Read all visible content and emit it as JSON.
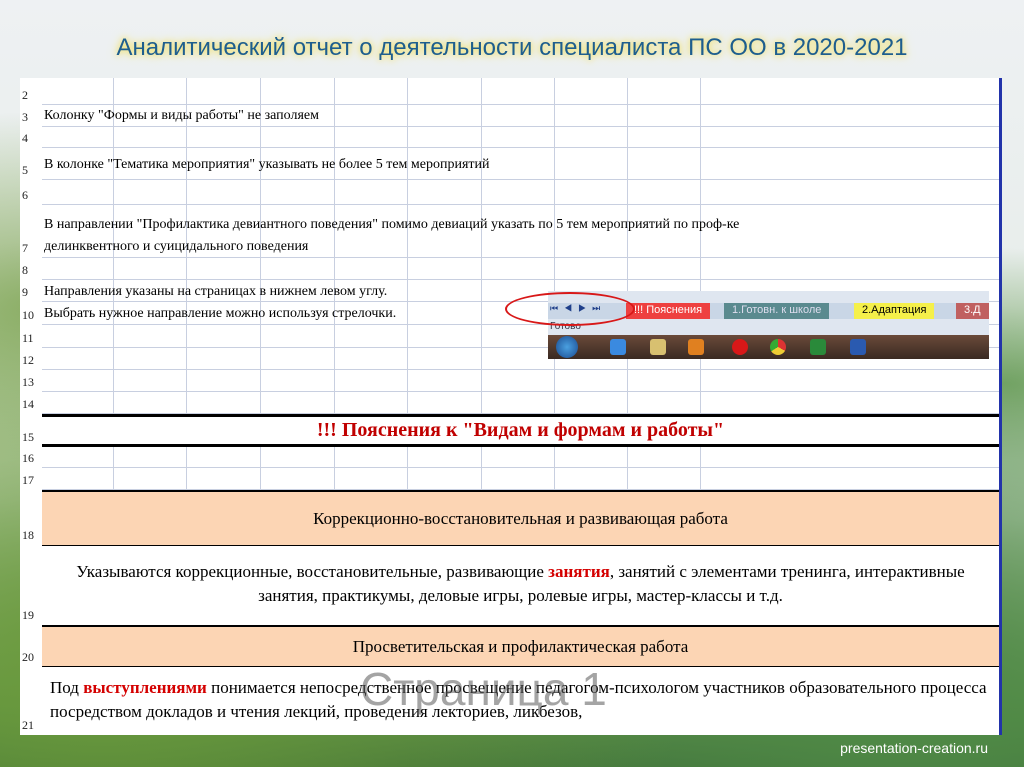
{
  "title": "Аналитический отчет о деятельности специалиста  ПС ОО в 2020-2021",
  "rows": [
    "2",
    "3",
    "4",
    "5",
    "6",
    "7",
    "8",
    "9",
    "10",
    "11",
    "12",
    "13",
    "14",
    "15",
    "16",
    "17",
    "18",
    "19",
    "20",
    "21"
  ],
  "notes": {
    "r3": "Колонку \"Формы и виды работы\" не заполяем",
    "r5": "В колонке \"Тематика мероприятия\" указывать не более 5 тем мероприятий",
    "r7a": "В направлении \"Профилактика девиантного поведения\" помимо девиаций указать по 5 тем мероприятий по проф-ке",
    "r7b": "делинквентного и суицидального поведения",
    "r9": "Направления указаны на страницах в нижнем левом углу.",
    "r10": "Выбрать нужное направление можно используя стрелочки."
  },
  "header15": "!!! Пояснения к \"Видам и формам и работы\"",
  "section1": {
    "title": "Коррекционно-восстановительная и развивающая работа",
    "text_a": "Указываются коррекционные, восстановительные, развивающие ",
    "highlight": "занятия",
    "text_b": ", занятий с элементами тренинга, интерактивные занятия, практикумы, деловые игры, ролевые игры, мастер-классы и т.д."
  },
  "section2": {
    "title": "Просветительская и профилактическая работа",
    "text_a": "Под ",
    "highlight": "выступлениями",
    "text_b": " понимается непосредственное просвещение педагогом-психологом участников образовательного процесса посредством докладов и чтения лекций, проведения лекториев, ликбезов,"
  },
  "inset": {
    "nav": "⏮◀▶⏭",
    "tabs": [
      "!!! Пояснения",
      "1.Готовн. к школе",
      "2.Адаптация",
      "3.Д"
    ],
    "status": "Готово"
  },
  "watermark": "Страница 1",
  "footer": "presentation-creation.ru"
}
